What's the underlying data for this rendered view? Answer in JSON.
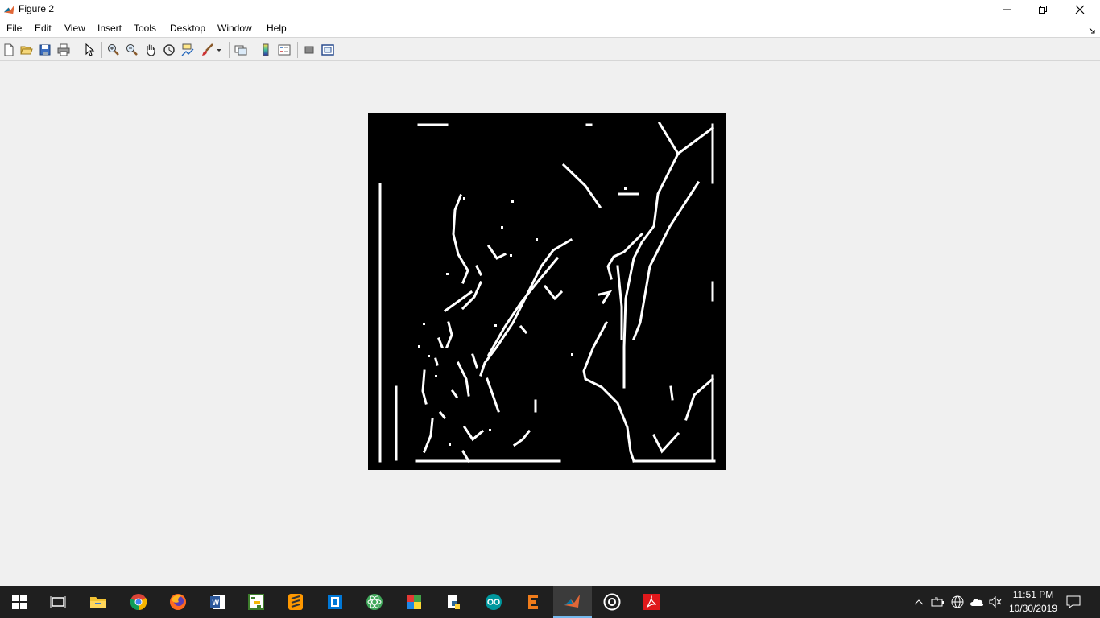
{
  "window": {
    "title": "Figure 2"
  },
  "menu": [
    "File",
    "Edit",
    "View",
    "Insert",
    "Tools",
    "Desktop",
    "Window",
    "Help"
  ],
  "toolbar": {
    "icons": [
      "new-figure-icon",
      "open-file-icon",
      "save-icon",
      "print-icon",
      "pointer-icon",
      "zoom-in-icon",
      "zoom-out-icon",
      "pan-hand-icon",
      "rotate-3d-icon",
      "data-cursor-icon",
      "brush-icon",
      "link-plot-icon",
      "colorbar-icon",
      "legend-icon",
      "hide-plot-tools-icon",
      "show-plot-tools-icon"
    ]
  },
  "taskbar": {
    "apps": [
      "start-icon",
      "task-view-icon",
      "file-explorer-icon",
      "chrome-icon",
      "firefox-icon",
      "word-icon",
      "project-icon",
      "sublime-text-icon",
      "notepad-icon",
      "atom-icon",
      "office-icon",
      "python-icon",
      "arduino-icon",
      "e-app-icon",
      "matlab-icon",
      "obs-icon",
      "acrobat-icon"
    ],
    "active_app": "matlab-icon",
    "clock_time": "11:51 PM",
    "clock_date": "10/30/2019"
  },
  "colors": {
    "figure_bg": "#f0f0f0",
    "image_bg": "#000000",
    "edge_color": "#ffffff",
    "taskbar_bg": "#1f1f1f",
    "accent": "#76b9ed"
  }
}
